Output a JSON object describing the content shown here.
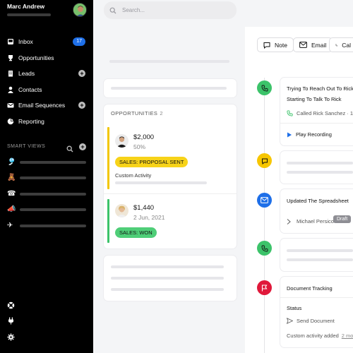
{
  "user": {
    "name": "Marc Andrew"
  },
  "sidebar": {
    "nav": [
      {
        "label": "Inbox",
        "icon": "inbox-icon",
        "badge": "17"
      },
      {
        "label": "Opportunities",
        "icon": "trophy-icon"
      },
      {
        "label": "Leads",
        "icon": "building-icon",
        "add": true
      },
      {
        "label": "Contacts",
        "icon": "person-icon"
      },
      {
        "label": "Email Sequences",
        "icon": "email-icon",
        "add": true
      },
      {
        "label": "Reporting",
        "icon": "pie-chart-icon"
      }
    ],
    "smart_views_title": "SMART VIEWS",
    "smart_views": [
      {
        "icon": "pinwheel-emoji"
      },
      {
        "icon": "teddy-bear-emoji"
      },
      {
        "icon": "telephone-emoji"
      },
      {
        "icon": "megaphone-emoji"
      },
      {
        "icon": "airplane-emoji"
      }
    ],
    "bottom_icons": [
      "help-icon",
      "plug-icon",
      "settings-icon"
    ]
  },
  "search": {
    "placeholder": "Search..."
  },
  "actions": {
    "note": "Note",
    "email": "Email",
    "call": "Cal"
  },
  "opportunities": {
    "title": "OPPORTUNITIES",
    "count": "2",
    "items": [
      {
        "amount": "$2,000",
        "sub": "50%",
        "status": "SALES: PROPOSAL SENT",
        "status_color": "#f7d319",
        "bar_color": "#f2c600",
        "activity": "Custom Activity"
      },
      {
        "amount": "$1,440",
        "sub": "2 Jun, 2021",
        "status": "SALES: WON",
        "status_color": "#4fce78",
        "bar_color": "#3cc36a"
      }
    ]
  },
  "timeline": {
    "call": {
      "title1": "Trying To Reach Out To Rick",
      "title2": "Starting To Talk To Rick",
      "called": "Called Rick Sanchez · 1 mi",
      "play": "Play Recording",
      "color": "#3cc36a"
    },
    "note_color": "#f7c600",
    "email": {
      "title": "Updated The Spreadsheet",
      "from": "Michael Persico",
      "draft": "Draft",
      "color": "#1e6fe8"
    },
    "call2_color": "#3cc36a",
    "task": {
      "title": "Document Tracking",
      "status_label": "Status",
      "send": "Send Document",
      "custom": "Custom activity added",
      "custom_time": "2 mont",
      "color": "#e0183a"
    }
  }
}
